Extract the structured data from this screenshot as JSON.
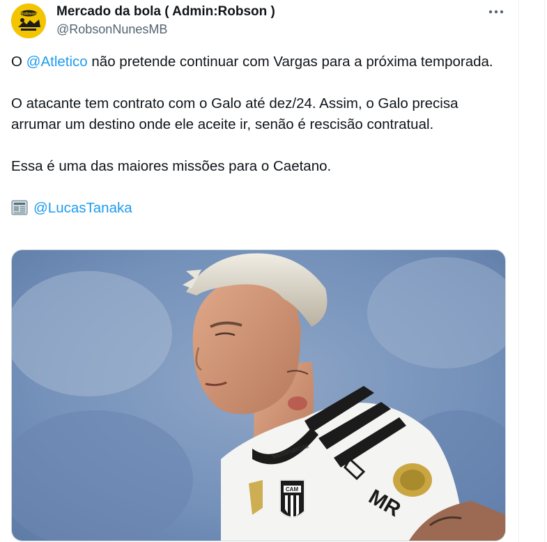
{
  "tweet": {
    "display_name": "Mercado da bola ( Admin:Robson )",
    "handle": "@RobsonNunesMB",
    "avatar_text": "Robson",
    "paragraph1_prefix": "O ",
    "paragraph1_mention": "@Atletico",
    "paragraph1_suffix": " não pretende continuar com Vargas para a próxima temporada.",
    "paragraph2": "O atacante tem contrato com o Galo até dez/24. Assim, o Galo precisa arrumar um destino onde ele aceite ir, senão é rescisão contratual.",
    "paragraph3": "Essa é uma das maiores missões para o Caetano.",
    "source_icon": "newspaper-icon",
    "source_mention": "@LucasTanaka",
    "more_icon": "more-dots-icon",
    "media": {
      "jersey_sponsor_1": "Multimarcas",
      "jersey_sponsor_2": "MR",
      "crest_text": "CAM"
    }
  },
  "colors": {
    "text": "#0f1419",
    "secondary": "#536471",
    "link": "#1d9bf0",
    "avatar_bg": "#f3c400"
  }
}
